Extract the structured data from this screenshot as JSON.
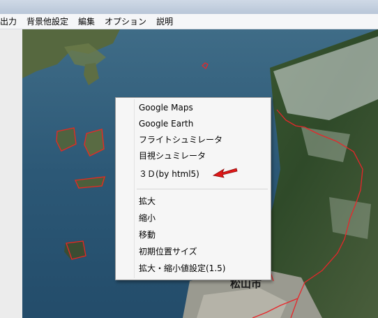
{
  "menubar": {
    "items": [
      "出力",
      "背景他設定",
      "編集",
      "オプション",
      "説明"
    ]
  },
  "map": {
    "label_city": "松山市"
  },
  "context_menu": {
    "group1": [
      "Google Maps",
      "Google Earth",
      "フライトシュミレータ",
      "目視シュミレータ",
      "３Ｄ(by html5)"
    ],
    "group2": [
      "拡大",
      "縮小",
      "移動",
      "初期位置サイズ",
      "拡大・縮小値設定(1.5)"
    ]
  },
  "colors": {
    "route_line": "#e8262a",
    "arrow": "#e01818"
  }
}
